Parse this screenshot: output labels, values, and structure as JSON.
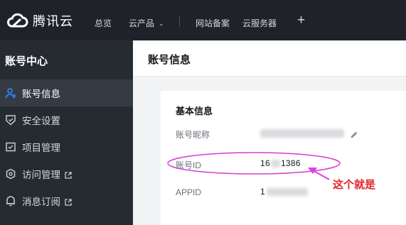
{
  "brand": {
    "name": "腾讯云"
  },
  "topnav": {
    "overview": "总览",
    "products": "云产品",
    "icp": "网站备案",
    "cvm": "云服务器",
    "plus": "+"
  },
  "sidebar": {
    "title": "账号中心",
    "items": [
      {
        "label": "账号信息",
        "active": true,
        "icon": "user-icon"
      },
      {
        "label": "安全设置",
        "active": false,
        "icon": "shield-icon"
      },
      {
        "label": "项目管理",
        "active": false,
        "icon": "folder-icon"
      },
      {
        "label": "访问管理",
        "active": false,
        "icon": "gear-icon",
        "external": true
      },
      {
        "label": "消息订阅",
        "active": false,
        "icon": "bell-icon",
        "external": true
      }
    ]
  },
  "main": {
    "title": "账号信息",
    "card": {
      "title": "基本信息",
      "fields": [
        {
          "label": "账号昵称",
          "value": ""
        },
        {
          "label": "账号ID",
          "value_start": "16",
          "value_end": "1386"
        },
        {
          "label": "APPID",
          "value_start": "1",
          "value_end": ""
        }
      ]
    }
  },
  "annotation": {
    "text": "这个就是",
    "color": "#e3262b",
    "ellipse_color": "#d63ad6"
  },
  "colors": {
    "topbar": "#1f2329",
    "sidebar": "#262b32",
    "sidebar_active": "#353b44",
    "accent": "#006eff"
  }
}
